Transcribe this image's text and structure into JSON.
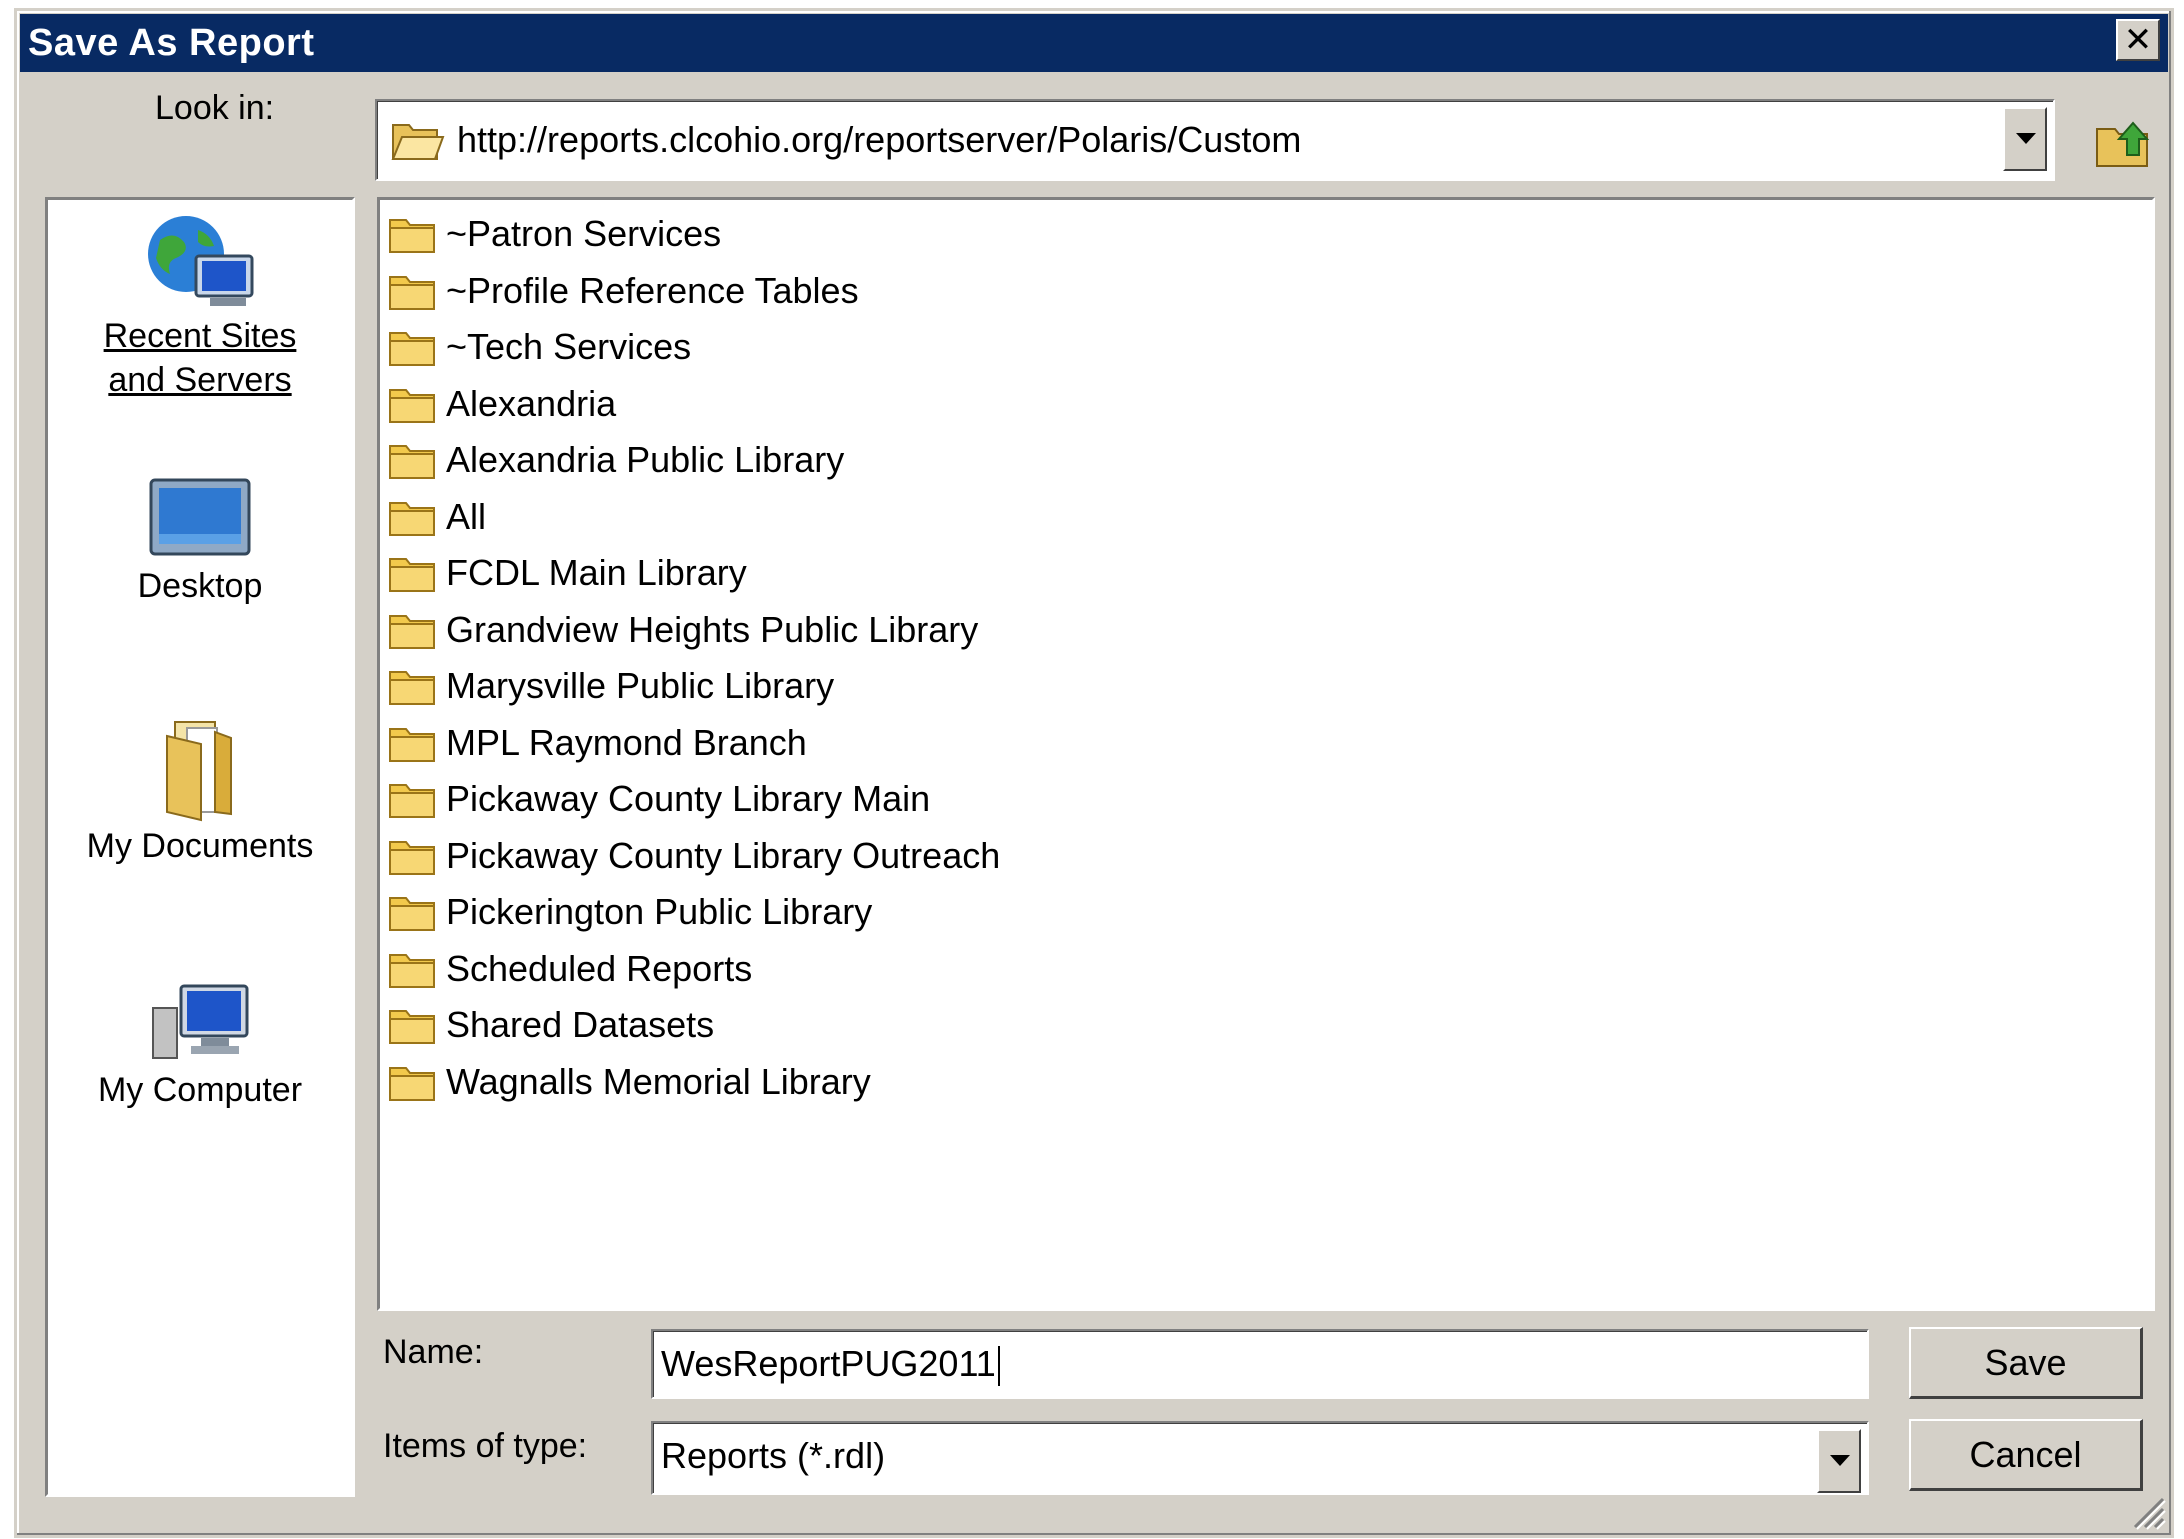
{
  "window": {
    "title": "Save As Report"
  },
  "look_in": {
    "label": "Look in:",
    "value": "http://reports.clcohio.org/reportserver/Polaris/Custom"
  },
  "places": [
    {
      "label_line1": "Recent Sites",
      "label_line2": "and Servers",
      "icon": "globe-computer-icon"
    },
    {
      "label": "Desktop",
      "icon": "desktop-icon"
    },
    {
      "label": "My Documents",
      "icon": "folder-documents-icon"
    },
    {
      "label": "My Computer",
      "icon": "computer-icon"
    }
  ],
  "files": [
    "~Patron Services",
    "~Profile Reference Tables",
    "~Tech Services",
    "Alexandria",
    "Alexandria Public Library",
    "All",
    "FCDL Main Library",
    "Grandview Heights Public Library",
    "Marysville Public Library",
    "MPL Raymond Branch",
    "Pickaway County Library Main",
    "Pickaway County Library Outreach",
    "Pickerington Public Library",
    "Scheduled Reports",
    "Shared Datasets",
    "Wagnalls Memorial Library"
  ],
  "name_field": {
    "label": "Name:",
    "value": "WesReportPUG2011"
  },
  "type_field": {
    "label": "Items of type:",
    "value": "Reports (*.rdl)"
  },
  "buttons": {
    "save": "Save",
    "cancel": "Cancel"
  },
  "colors": {
    "title_bar": "#082a63",
    "dialog_bg": "#d4d0c8",
    "folder": "#f2c94c"
  }
}
